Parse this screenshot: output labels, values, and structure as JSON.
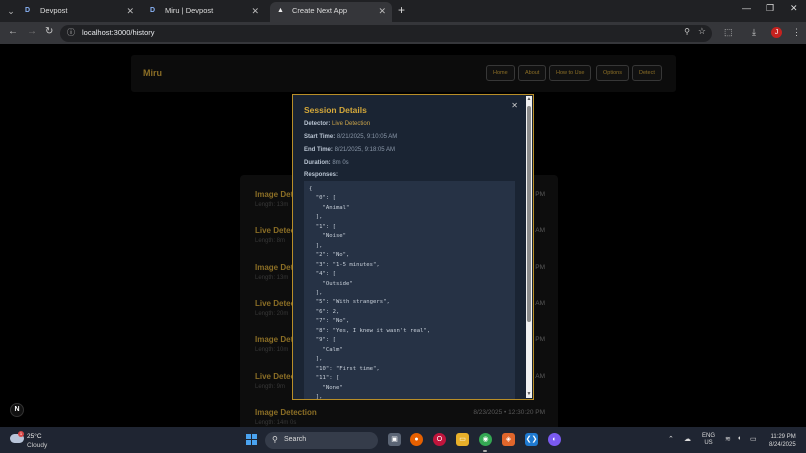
{
  "browser": {
    "tabs": [
      {
        "favicon": "D",
        "title": "Devpost",
        "active": false
      },
      {
        "favicon": "D",
        "title": "Miru | Devpost",
        "active": false
      },
      {
        "favicon": "▲",
        "title": "Create Next App",
        "active": true
      }
    ],
    "url": "localhost:3000/history"
  },
  "app": {
    "brand": "Miru",
    "nav": [
      "Home",
      "About",
      "How to Use",
      "Options",
      "Detect"
    ]
  },
  "history": [
    {
      "title": "Image Detec",
      "sub": "Length: 13m",
      "time": "PM"
    },
    {
      "title": "Live Detec",
      "sub": "Length: 8m",
      "time": "AM"
    },
    {
      "title": "Image Detec",
      "sub": "Length: 13m",
      "time": "PM"
    },
    {
      "title": "Live Detec",
      "sub": "Length: 20m",
      "time": "AM"
    },
    {
      "title": "Image Detec",
      "sub": "Length: 10m",
      "time": "PM"
    },
    {
      "title": "Live Detec",
      "sub": "Length: 9m",
      "time": "AM"
    },
    {
      "title": "Image Detection",
      "sub": "Length: 14m 0s",
      "time": "8/23/2025 • 12:30:20 PM"
    }
  ],
  "modal": {
    "title": "Session Details",
    "detector_label": "Detector:",
    "detector_value": "Live Detection",
    "start_label": "Start Time:",
    "start_value": "8/21/2025, 9:10:05 AM",
    "end_label": "End Time:",
    "end_value": "8/21/2025, 9:18:05 AM",
    "duration_label": "Duration:",
    "duration_value": "8m 0s",
    "responses_label": "Responses:",
    "responses_text": "{\n  \"0\": [\n    \"Animal\"\n  ],\n  \"1\": [\n    \"Noise\"\n  ],\n  \"2\": \"No\",\n  \"3\": \"1-5 minutes\",\n  \"4\": [\n    \"Outside\"\n  ],\n  \"5\": \"With strangers\",\n  \"6\": 2,\n  \"7\": \"No\",\n  \"8\": \"Yes, I knew it wasn't real\",\n  \"9\": [\n    \"Calm\"\n  ],\n  \"10\": \"First time\",\n  \"11\": [\n    \"None\"\n  ],"
  },
  "taskbar": {
    "temp": "25°C",
    "condition": "Cloudy",
    "search": "Search",
    "lang": "ENG",
    "region": "US",
    "time": "11:29 PM",
    "date": "8/24/2025"
  }
}
